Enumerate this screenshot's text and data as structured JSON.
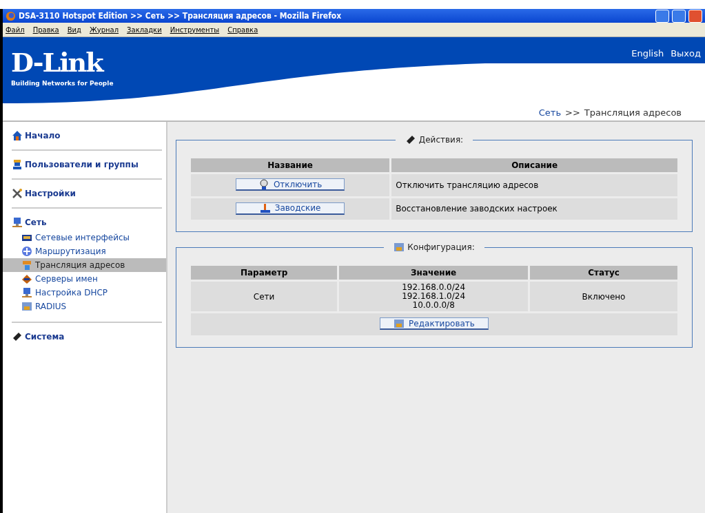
{
  "window": {
    "title": "DSA-3110 Hotspot Edition >> Сеть >> Трансляция адресов - Mozilla Firefox"
  },
  "menu": [
    "Файл",
    "Правка",
    "Вид",
    "Журнал",
    "Закладки",
    "Инструменты",
    "Справка"
  ],
  "header": {
    "logo": "D-Link",
    "tagline": "Building Networks for People",
    "links": [
      "English",
      "Выход"
    ]
  },
  "breadcrumb": {
    "link": "Сеть",
    "separator": ">>",
    "current": "Трансляция адресов"
  },
  "sidebar": [
    {
      "label": "Начало"
    },
    {
      "label": "Пользователи и группы"
    },
    {
      "label": "Настройки"
    },
    {
      "label": "Сеть",
      "children": [
        {
          "label": "Сетевые интерфейсы",
          "selected": false
        },
        {
          "label": "Маршрутизация",
          "selected": false
        },
        {
          "label": "Трансляция адресов",
          "selected": true
        },
        {
          "label": "Серверы имен",
          "selected": false
        },
        {
          "label": "Настройка DHCP",
          "selected": false
        },
        {
          "label": "RADIUS",
          "selected": false
        }
      ]
    },
    {
      "label": "Система"
    }
  ],
  "actions": {
    "legend": "Действия:",
    "columns": [
      "Название",
      "Описание"
    ],
    "rows": [
      {
        "button": "Отключить",
        "description": "Отключить трансляцию адресов"
      },
      {
        "button": "Заводские",
        "description": "Восстановление заводских настроек"
      }
    ]
  },
  "config": {
    "legend": "Конфигурация:",
    "columns": [
      "Параметр",
      "Значение",
      "Статус"
    ],
    "rows": [
      {
        "parameter": "Сети",
        "values": [
          "192.168.0.0/24",
          "192.168.1.0/24",
          "10.0.0.0/8"
        ],
        "status": "Включено"
      }
    ],
    "edit_button": "Редактировать"
  }
}
